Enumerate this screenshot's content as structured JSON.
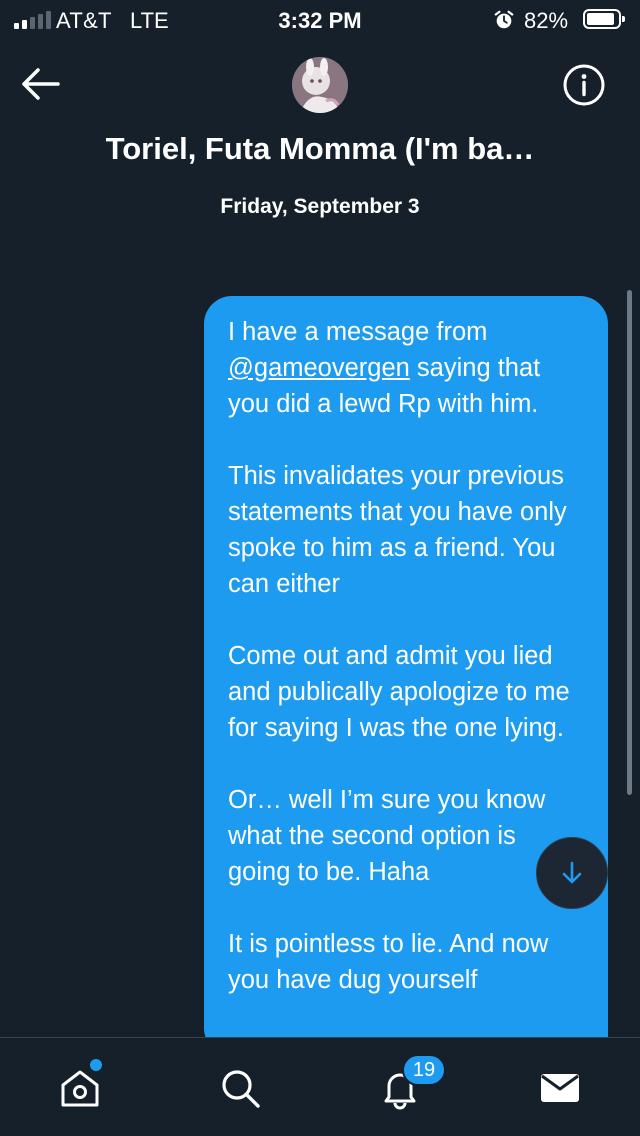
{
  "status_bar": {
    "carrier": "AT&T",
    "network": "LTE",
    "time": "3:32 PM",
    "battery": "82%",
    "battery_level": 0.82,
    "signal_bars": 2,
    "icons": [
      "signal-icon",
      "alarm-icon",
      "battery-icon"
    ]
  },
  "header": {
    "title": "Toriel, Futa Momma (I'm ba…",
    "back_icon": "arrow-left-icon",
    "info_icon": "info-icon",
    "avatar": "avatar"
  },
  "conversation": {
    "date_separator": "Friday, September 3",
    "message": {
      "p1_line1": "I have a message from",
      "p1_mention": "@gameovergen",
      "p1_rest": " saying that you did a lewd Rp with him.",
      "p2": "This invalidates your previous statements that you have only spoke to him as a friend. You can either",
      "p3": "Come out and admit you lied and publically apologize to me for saying I was the one lying.",
      "p4": "Or… well I’m sure you know what the second option is going to be. Haha",
      "p5": "It is pointless to lie. And now you have dug yourself"
    },
    "scroll_button_icon": "arrow-down-icon"
  },
  "tabbar": {
    "tabs": [
      {
        "name": "home",
        "icon": "home-icon"
      },
      {
        "name": "search",
        "icon": "search-icon"
      },
      {
        "name": "notifications",
        "icon": "bell-icon"
      },
      {
        "name": "messages",
        "icon": "mail-icon"
      }
    ],
    "notifications_count": "19"
  },
  "colors": {
    "background": "#15202b",
    "accent": "#1d9bf0",
    "divider": "#38444d"
  }
}
